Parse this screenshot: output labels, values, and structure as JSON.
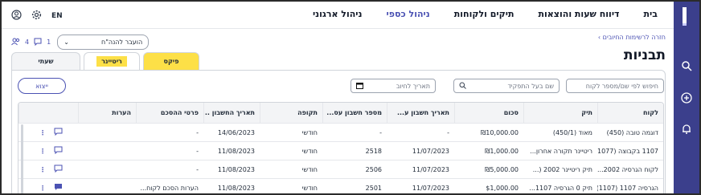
{
  "nav": [
    "בית",
    "דיווח שעות והוצאות",
    "תיקים ולקוחות",
    "ניהול כספי",
    "ניהול ארגוני"
  ],
  "nav_active": "ניהול כספי",
  "lang": "EN",
  "back_link": "חזרה לרשימות החיובים",
  "page_title": "תבניות",
  "counters": {
    "people": "4",
    "comments": "1"
  },
  "assign_select": "הועבר להנה\"ח",
  "tabs": [
    "שעתי",
    "ריטיינר",
    "פיקס"
  ],
  "filters": {
    "client_placeholder": "חיפוש לפי שם/מספר לקוח",
    "role_placeholder": "שם בעל התפקיד",
    "date_placeholder": "תאריך לחיוב",
    "export_label": "ייצוא"
  },
  "table": {
    "headers": [
      "לקוח",
      "תיק",
      "סכום",
      "תאריך חשבון ע...",
      "מספר חשבון עס...",
      "תקופה",
      "תאריך החשבון ...",
      "פרטי ההסכם",
      "הערות"
    ],
    "rows": [
      [
        "דוגמה טובה (450)",
        "מאוד (450/1)",
        "₪10,000.00",
        "-",
        "-",
        "חודשי",
        "14/06/2023",
        "-"
      ],
      [
        "1107 בקבוצה (1077...",
        "ריטיינר תקורה אחרון...",
        "₪1,000.00",
        "11/07/2023",
        "2518",
        "חודשי",
        "11/08/2023",
        "-"
      ],
      [
        "לקוח הגרסיה 2002...",
        "תיק ריטיינר 2002 (...",
        "₪5,000.00",
        "11/07/2023",
        "2506",
        "חודשי",
        "11/08/2023",
        "-"
      ],
      [
        "הגרסיה 1107 (1107)",
        "תיק 0 הגרסיה 1107...",
        "$1,000.00",
        "11/07/2023",
        "2501",
        "חודשי",
        "11/08/2023",
        "הערות הסכם לקוח..."
      ]
    ]
  }
}
